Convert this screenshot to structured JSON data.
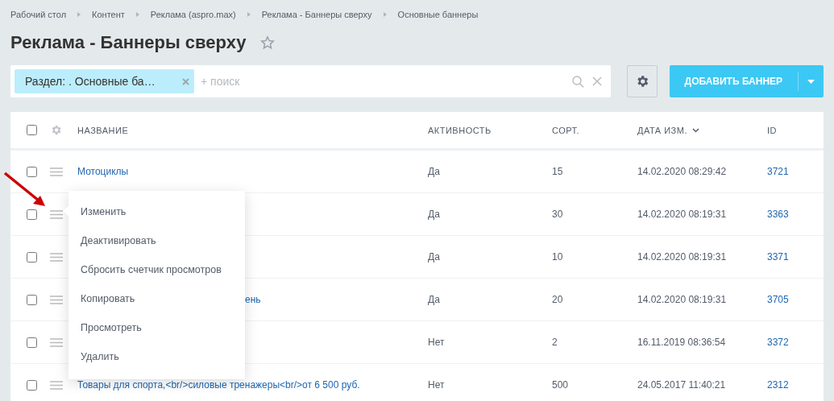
{
  "breadcrumbs": [
    "Рабочий стол",
    "Контент",
    "Реклама (aspro.max)",
    "Реклама - Баннеры сверху",
    "Основные баннеры"
  ],
  "title": "Реклама - Баннеры сверху",
  "favorite": false,
  "filter": {
    "tag": "Раздел: . Основные ба…",
    "placeholder": "+ поиск"
  },
  "add_button": "ДОБАВИТЬ БАННЕР",
  "table": {
    "select_all_checked": false,
    "columns": [
      {
        "label": "НАЗВАНИЕ",
        "sorted": false
      },
      {
        "label": "АКТИВНОСТЬ",
        "sorted": false
      },
      {
        "label": "СОРТ.",
        "sorted": false
      },
      {
        "label": "ДАТА ИЗМ.",
        "sorted": true
      },
      {
        "label": "ID",
        "sorted": false
      }
    ],
    "rows": [
      {
        "checked": false,
        "kind": "link",
        "name": "Мотоциклы",
        "active": "Да",
        "sort": "15",
        "date": "14.02.2020 08:29:42",
        "id": "3721"
      },
      {
        "checked": false,
        "active": "Да",
        "sort": "30",
        "date": "14.02.2020 08:19:31",
        "id": "3363"
      },
      {
        "checked": false,
        "active": "Да",
        "sort": "10",
        "date": "14.02.2020 08:19:31",
        "id": "3371"
      },
      {
        "checked": false,
        "kind": "covered",
        "name": "ень",
        "active": "Да",
        "sort": "20",
        "date": "14.02.2020 08:19:31",
        "id": "3705"
      },
      {
        "checked": false,
        "active": "Нет",
        "sort": "2",
        "date": "16.11.2019 08:36:54",
        "id": "3372"
      },
      {
        "checked": false,
        "kind": "link",
        "name": "Товары для спорта,<br/>силовые тренажеры<br/>от 6 500 руб.",
        "active": "Нет",
        "sort": "500",
        "date": "24.05.2017 11:40:21",
        "id": "2312"
      }
    ]
  },
  "context_menu": [
    "Изменить",
    "Деактивировать",
    "Сбросить счетчик просмотров",
    "Копировать",
    "Просмотреть",
    "Удалить"
  ]
}
